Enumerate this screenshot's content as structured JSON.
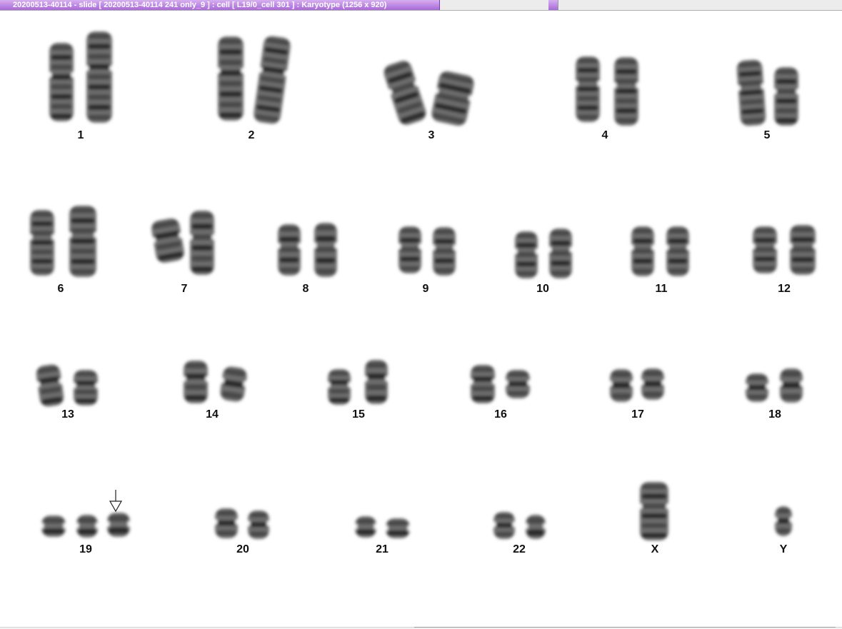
{
  "window": {
    "title": "20200513-40114 - slide [ 20200513-40114 241 only_9 ] : cell [ L19/0_cell 301 ] : Karyotype  (1256 x 920)"
  },
  "colors": {
    "tab_accent": "#a86ad8",
    "chromosome": "#333333"
  },
  "karyotype": {
    "labels": [
      "1",
      "2",
      "3",
      "4",
      "5",
      "6",
      "7",
      "8",
      "9",
      "10",
      "11",
      "12",
      "13",
      "14",
      "15",
      "16",
      "17",
      "18",
      "19",
      "20",
      "21",
      "22",
      "X",
      "Y"
    ],
    "marker_icon": "arrow-down-icon"
  }
}
